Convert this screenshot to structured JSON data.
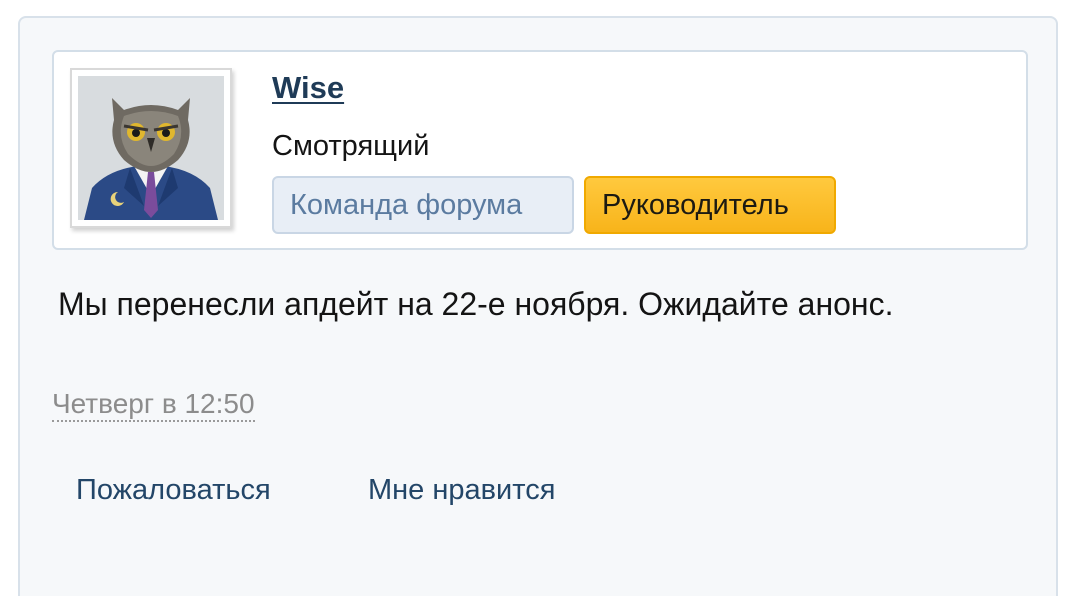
{
  "post": {
    "author": {
      "username": "Wise",
      "user_title": "Смотрящий",
      "avatar_icon": "owl-in-suit-avatar",
      "banners": [
        {
          "label": "Команда форума",
          "color": "#e8eef6"
        },
        {
          "label": "Руководитель",
          "color": "#f8b41a"
        }
      ]
    },
    "message": "Мы перенесли апдейт на 22-е ноября. Ожидайте анонс.",
    "date": "Четверг в 12:50",
    "actions": {
      "report": "Пожаловаться",
      "like": "Мне нравится"
    }
  }
}
